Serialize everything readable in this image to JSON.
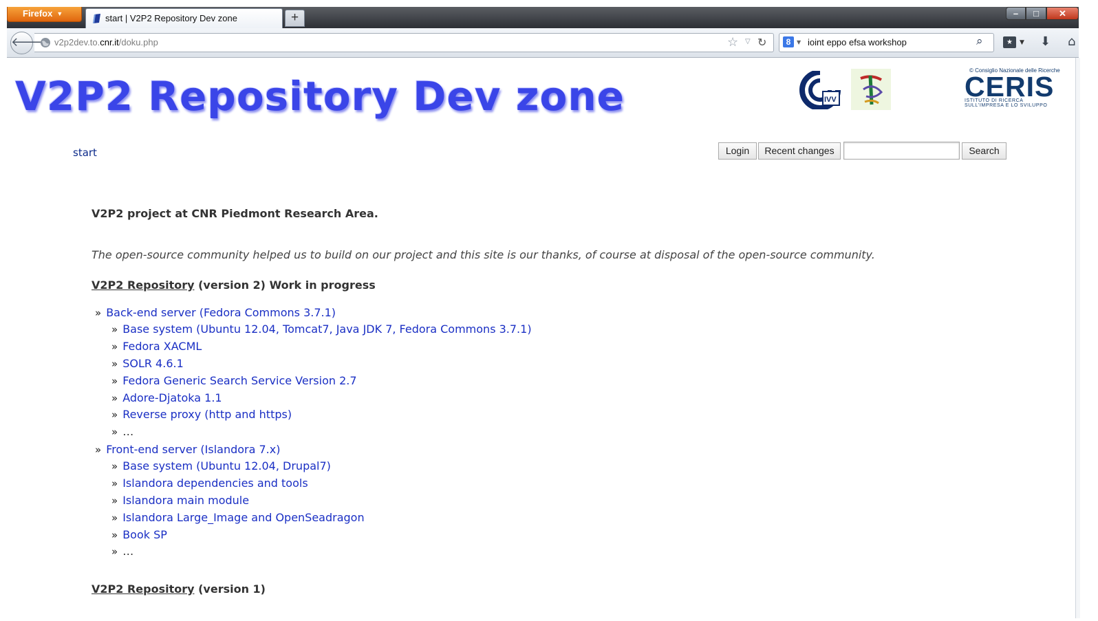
{
  "browser": {
    "menu_label": "Firefox",
    "tab_title": "start | V2P2 Repository Dev zone",
    "new_tab_label": "+",
    "url_prefix": "v2p2dev.to.",
    "url_domain": "cnr.it",
    "url_path": "/doku.php",
    "search_text": "ioint eppo efsa workshop",
    "search_engine_letter": "8",
    "window_minimize": "–",
    "window_maximize": "□",
    "window_close": "✕"
  },
  "header": {
    "site_title": "V2P2 Repository Dev zone",
    "logo_cnr_name": "cnr-logo",
    "logo_ivv_name": "ivv-logo",
    "ceris_small": "Consiglio Nazionale delle Ricerche",
    "ceris_name": "CERIS",
    "ceris_sub1": "ISTITUTO  DI  RICERCA",
    "ceris_sub2": "SULL'IMPRESA E LO SVILUPPO"
  },
  "nav": {
    "breadcrumb": "start",
    "login": "Login",
    "recent_changes": "Recent changes",
    "search_value": "",
    "search_button": "Search"
  },
  "content": {
    "intro": "V2P2 project at CNR Piedmont Research Area.",
    "thanks": "The open-source community helped us to build on our project and this site is our thanks, of course at disposal of the open-source community.",
    "heading_v2_link": "V2P2 Repository",
    "heading_v2_rest": " (version 2) Work in progress",
    "backend": {
      "label": "Back-end server (Fedora Commons 3.7.1)",
      "items": [
        "Base system (Ubuntu 12.04, Tomcat7, Java JDK 7, Fedora Commons 3.7.1)",
        "Fedora XACML",
        "SOLR 4.6.1",
        "Fedora Generic Search Service Version 2.7",
        "Adore-Djatoka 1.1",
        "Reverse proxy (http and https)",
        "…"
      ]
    },
    "frontend": {
      "label": "Front-end server (Islandora 7.x)",
      "items": [
        "Base system (Ubuntu 12.04, Drupal7)",
        "Islandora dependencies and tools",
        "Islandora main module",
        "Islandora Large_Image and OpenSeadragon",
        "Book SP",
        "…"
      ]
    },
    "bullet": "»",
    "heading_v1_link": "V2P2 Repository",
    "heading_v1_rest": " (version 1)"
  },
  "colors": {
    "title_blue": "#3a45e8",
    "link_blue": "#1a2fc4",
    "firefox_orange": "#e0660e"
  }
}
